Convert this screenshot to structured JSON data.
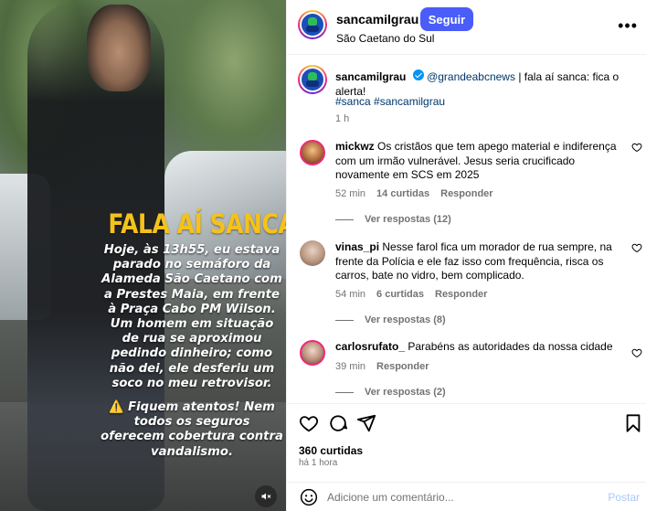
{
  "media": {
    "overlay_title": "FALA AÍ SANCA",
    "overlay_body": "Hoje, às 13h55, eu estava parado no semáforo da Alameda São Caetano com a Prestes Maia, em frente à Praça Cabo PM Wilson. Um homem em situação de rua se aproximou pedindo dinheiro; como não dei, ele desferiu um soco no meu retrovisor.",
    "overlay_warning_glyph": "⚠️",
    "overlay_warning": "Fiquem atentos! Nem todos os seguros oferecem cobertura contra vandalismo.",
    "mute_icon": "speaker-muted-icon"
  },
  "header": {
    "username": "sancamilgrau",
    "separator": "•",
    "follow_label": "Seguir",
    "location": "São Caetano do Sul",
    "more_icon": "more-horizontal-icon"
  },
  "caption": {
    "username": "sancamilgrau",
    "mention": "@grandeabcnews",
    "text": " | fala aí sanca: fica o alerta!",
    "hashtags": "#sanca #sancamilgrau",
    "time": "1 h"
  },
  "comments": [
    {
      "username": "mickwz",
      "text": "Os cristãos que tem apego material e indiferença com um irmão vulnerável. Jesus seria crucificado novamente em SCS em 2025",
      "time": "52 min",
      "likes": "14 curtidas",
      "reply": "Responder",
      "view_replies": "Ver respostas (12)"
    },
    {
      "username": "vinas_pi",
      "text": "Nesse farol fica um morador de rua sempre, na frente da Polícia e ele faz isso com frequência, risca os carros, bate no vidro, bem complicado.",
      "time": "54 min",
      "likes": "6 curtidas",
      "reply": "Responder",
      "view_replies": "Ver respostas (8)"
    },
    {
      "username": "carlosrufato_",
      "text": "Parabéns as autoridades da nossa cidade",
      "time": "39 min",
      "reply": "Responder",
      "view_replies": "Ver respostas (2)"
    }
  ],
  "footer": {
    "likes": "360 curtidas",
    "time_ago": "há 1 hora",
    "comment_placeholder": "Adicione um comentário...",
    "post_label": "Postar"
  },
  "colors": {
    "accent": "#4a5df9",
    "link": "#00376b",
    "overlay_title": "#f5c21b",
    "muted_text": "#737373"
  }
}
